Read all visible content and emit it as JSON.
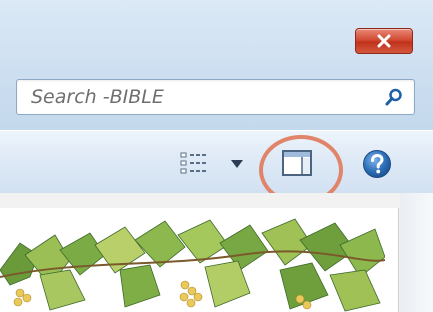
{
  "window": {
    "close_glyph": "x"
  },
  "search": {
    "placeholder": "Search -BIBLE",
    "value": ""
  },
  "toolbar": {
    "icons": [
      "view-icon",
      "chevron-down-icon",
      "preview-pane-icon",
      "help-icon"
    ]
  },
  "content": {
    "image": "vine-illustration"
  },
  "colors": {
    "close_red": "#c9381f",
    "highlight": "#e0856a",
    "help_blue": "#2d6fb8",
    "search_icon_blue": "#1e5fa8"
  }
}
